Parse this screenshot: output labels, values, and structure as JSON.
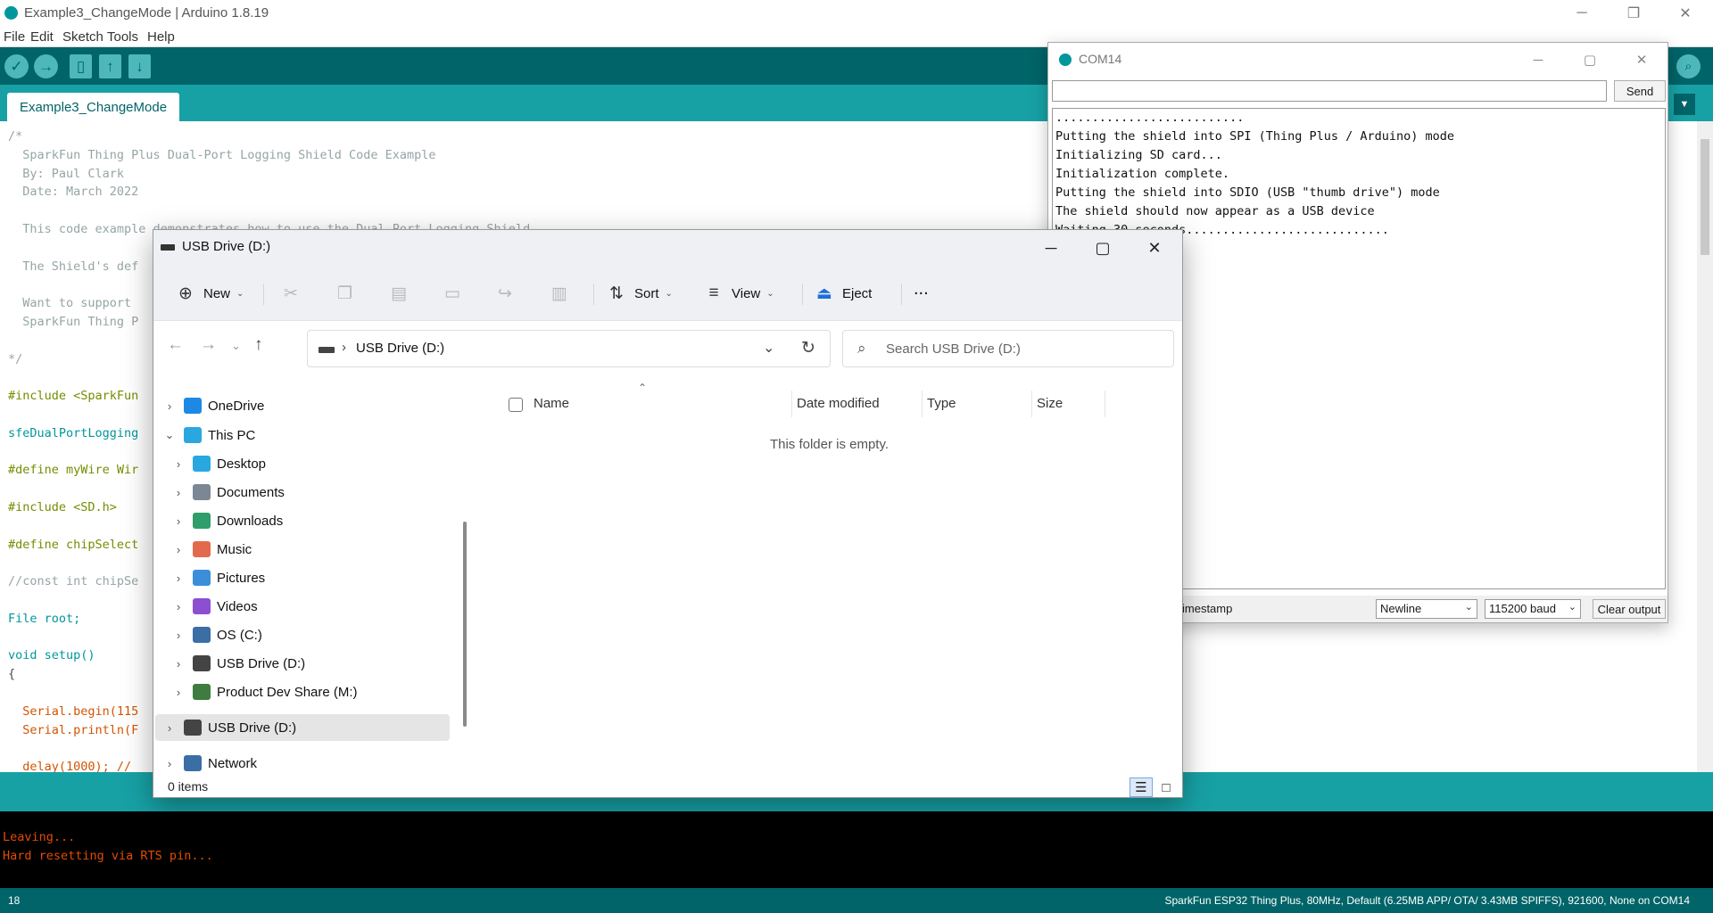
{
  "ide": {
    "title": "Example3_ChangeMode | Arduino 1.8.19",
    "menu": [
      "File",
      "Edit",
      "Sketch",
      "Tools",
      "Help"
    ],
    "tab_label": "Example3_ChangeMode",
    "code_lines": [
      "/*",
      "  SparkFun Thing Plus Dual-Port Logging Shield Code Example",
      "  By: Paul Clark",
      "  Date: March 2022",
      "",
      "  This code example demonstrates how to use the Dual-Port Logging Shield.",
      "",
      "  The Shield's def",
      "",
      "  Want to support",
      "  SparkFun Thing P",
      "",
      "*/",
      "",
      "#include <SparkFun",
      "",
      "sfeDualPortLogging",
      "",
      "#define myWire Wir",
      "",
      "#include <SD.h>",
      "",
      "#define chipSelect",
      "",
      "//const int chipSe",
      "",
      "File root;",
      "",
      "void setup()",
      "{",
      "",
      "  Serial.begin(115",
      "  Serial.println(F",
      "",
      "  delay(1000); //"
    ],
    "console_lines": [
      "Leaving...",
      "Hard resetting via RTS pin..."
    ],
    "line_number": "18",
    "board_info": "SparkFun ESP32 Thing Plus, 80MHz, Default (6.25MB APP/ OTA/ 3.43MB SPIFFS), 921600, None on COM14"
  },
  "serial_monitor": {
    "title": "COM14",
    "input_value": "",
    "send_label": "Send",
    "output_lines": [
      "..........................",
      "Putting the shield into SPI (Thing Plus / Arduino) mode",
      "Initializing SD card...",
      "Initialization complete.",
      "Putting the shield into SDIO (USB \"thumb drive\") mode",
      "The shield should now appear as a USB device",
      "Waiting 30 seconds............................"
    ],
    "timestamp_label": "imestamp",
    "line_ending": "Newline",
    "baud": "115200 baud",
    "clear_label": "Clear output"
  },
  "explorer": {
    "title": "USB Drive (D:)",
    "cmd": {
      "new": "New",
      "sort": "Sort",
      "view": "View",
      "eject": "Eject",
      "more": "..."
    },
    "path": "USB Drive (D:)",
    "search_placeholder": "Search USB Drive (D:)",
    "nav_items": [
      {
        "label": "OneDrive",
        "icon": "cloud-icon",
        "color": "#1e88e5"
      },
      {
        "label": "This PC",
        "icon": "pc-icon",
        "color": "#29a8e0"
      },
      {
        "label": "Desktop",
        "icon": "desktop-icon",
        "color": "#29a8e0"
      },
      {
        "label": "Documents",
        "icon": "documents-icon",
        "color": "#7b8794"
      },
      {
        "label": "Downloads",
        "icon": "downloads-icon",
        "color": "#2e9e6a"
      },
      {
        "label": "Music",
        "icon": "music-icon",
        "color": "#e3694e"
      },
      {
        "label": "Pictures",
        "icon": "pictures-icon",
        "color": "#3b8fd9"
      },
      {
        "label": "Videos",
        "icon": "videos-icon",
        "color": "#8b4fcf"
      },
      {
        "label": "OS (C:)",
        "icon": "os-drive-icon",
        "color": "#3a6ea5"
      },
      {
        "label": "USB Drive (D:)",
        "icon": "usb-drive-icon",
        "color": "#444444"
      },
      {
        "label": "Product Dev Share (M:)",
        "icon": "network-drive-icon",
        "color": "#3f7c3f"
      },
      {
        "label": "USB Drive (D:)",
        "icon": "usb-drive-icon",
        "color": "#444444"
      },
      {
        "label": "Network",
        "icon": "network-icon",
        "color": "#3a6ea5"
      }
    ],
    "columns": [
      "Name",
      "Date modified",
      "Type",
      "Size"
    ],
    "empty_message": "This folder is empty.",
    "item_count": "0 items"
  }
}
